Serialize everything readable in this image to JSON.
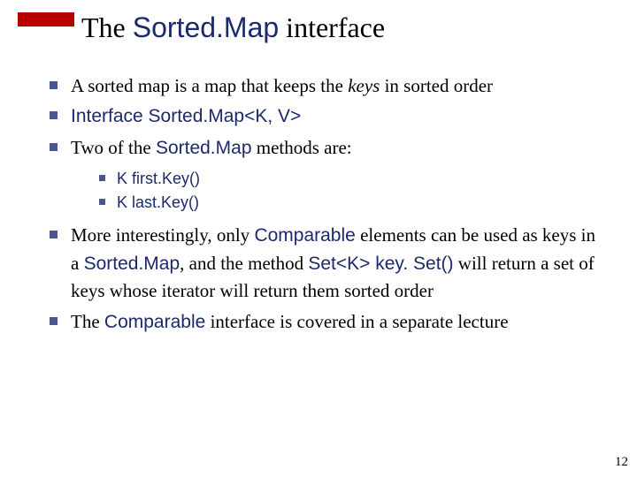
{
  "title": {
    "pre": "The ",
    "code": "Sorted.Map",
    "post": " interface"
  },
  "bullets": {
    "b1": {
      "t1": "A sorted map is a map that keeps the ",
      "em": "keys",
      "t2": " in sorted order"
    },
    "b2": "Interface Sorted.Map<K, V>",
    "b3": {
      "t1": "Two of the ",
      "code": "Sorted.Map",
      "t2": " methods are:"
    },
    "sub": {
      "s1": "K first.Key()",
      "s2": "K last.Key()"
    },
    "b4": {
      "t1": "More interestingly, only ",
      "c1": "Comparable",
      "t2": " elements can be used as keys in a ",
      "c2": "Sorted.Map",
      "t3": ", and the method ",
      "c3": "Set<K> key. Set()",
      "t4": " will return a set of keys whose iterator will return them sorted order"
    },
    "b5": {
      "t1": "The ",
      "c1": "Comparable",
      "t2": " interface is covered in a separate lecture"
    }
  },
  "pageNumber": "12"
}
